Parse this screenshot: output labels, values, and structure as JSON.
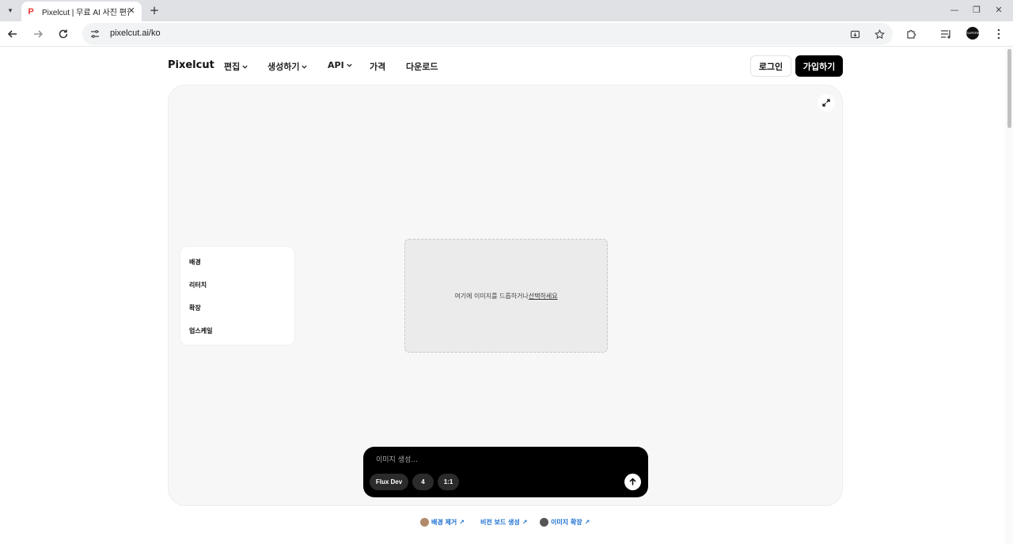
{
  "browser": {
    "tab_title": "Pixelcut | 무료 AI 사진 편집",
    "favicon_letter": "P",
    "url": "pixelcut.ai/ko",
    "avatar_text": "SUPERB"
  },
  "header": {
    "logo": "Pixelcut",
    "nav": [
      {
        "label": "편집"
      },
      {
        "label": "생성하기"
      },
      {
        "label": "API"
      },
      {
        "label": "가격"
      },
      {
        "label": "다운로드"
      }
    ],
    "login_label": "로그인",
    "signup_label": "가입하기"
  },
  "editor": {
    "tools": [
      "배경",
      "리터치",
      "확장",
      "업스케일"
    ],
    "dropzone_text": "여기에 이미지를 드롭하거나 ",
    "dropzone_link": "선택하세요"
  },
  "prompt": {
    "placeholder": "이미지 생성...",
    "model": "Flux Dev",
    "count": "4",
    "ratio": "1:1"
  },
  "footer_links": [
    "배경 제거",
    "비전 보드 생성",
    "이미지 확장"
  ]
}
